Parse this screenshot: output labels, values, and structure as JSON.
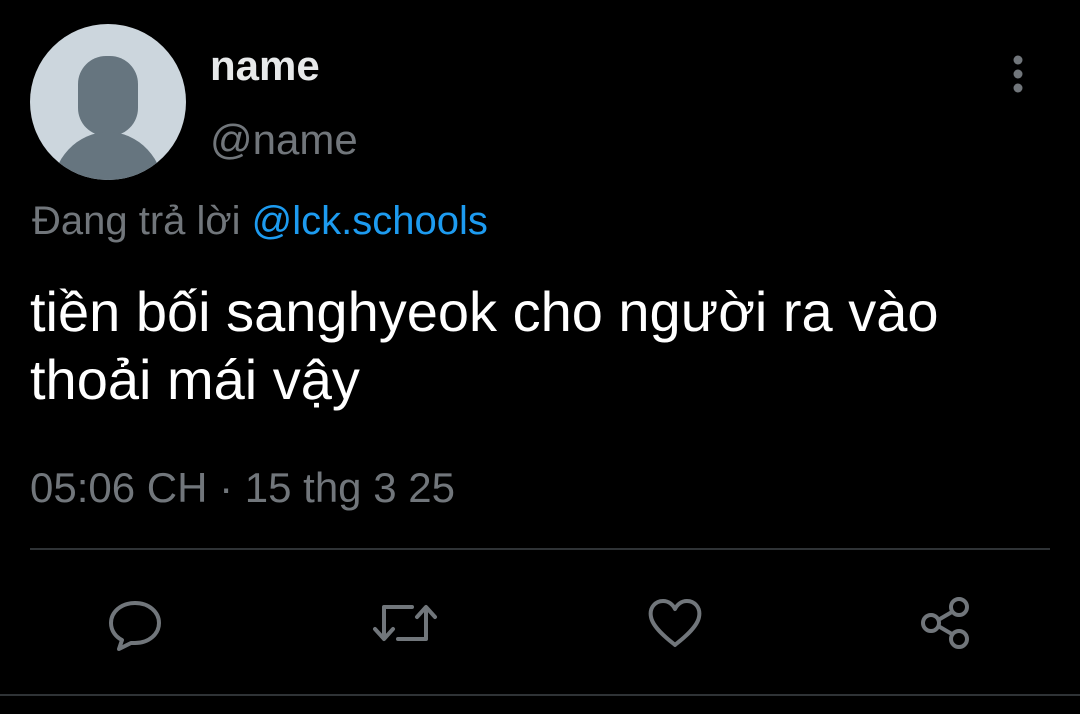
{
  "tweet": {
    "display_name": "name",
    "handle": "@name",
    "reply_prefix": "Đang trả lời ",
    "reply_mention": "@lck.schools",
    "text": "tiền bối sanghyeok cho người ra vào thoải mái vậy",
    "timestamp": "05:06 CH · 15 thg 3 25"
  },
  "icons": {
    "avatar": "default-avatar-silhouette",
    "more": "vertical-ellipsis-icon",
    "reply": "speech-bubble-icon",
    "retweet": "retweet-arrows-icon",
    "like": "heart-icon",
    "share": "share-nodes-icon"
  },
  "colors": {
    "background": "#000000",
    "text": "#ffffff",
    "muted": "#71767b",
    "link": "#1d9bf0",
    "divider": "#2f3336",
    "avatar_bg": "#ccd6dd",
    "avatar_fg": "#66757f"
  }
}
